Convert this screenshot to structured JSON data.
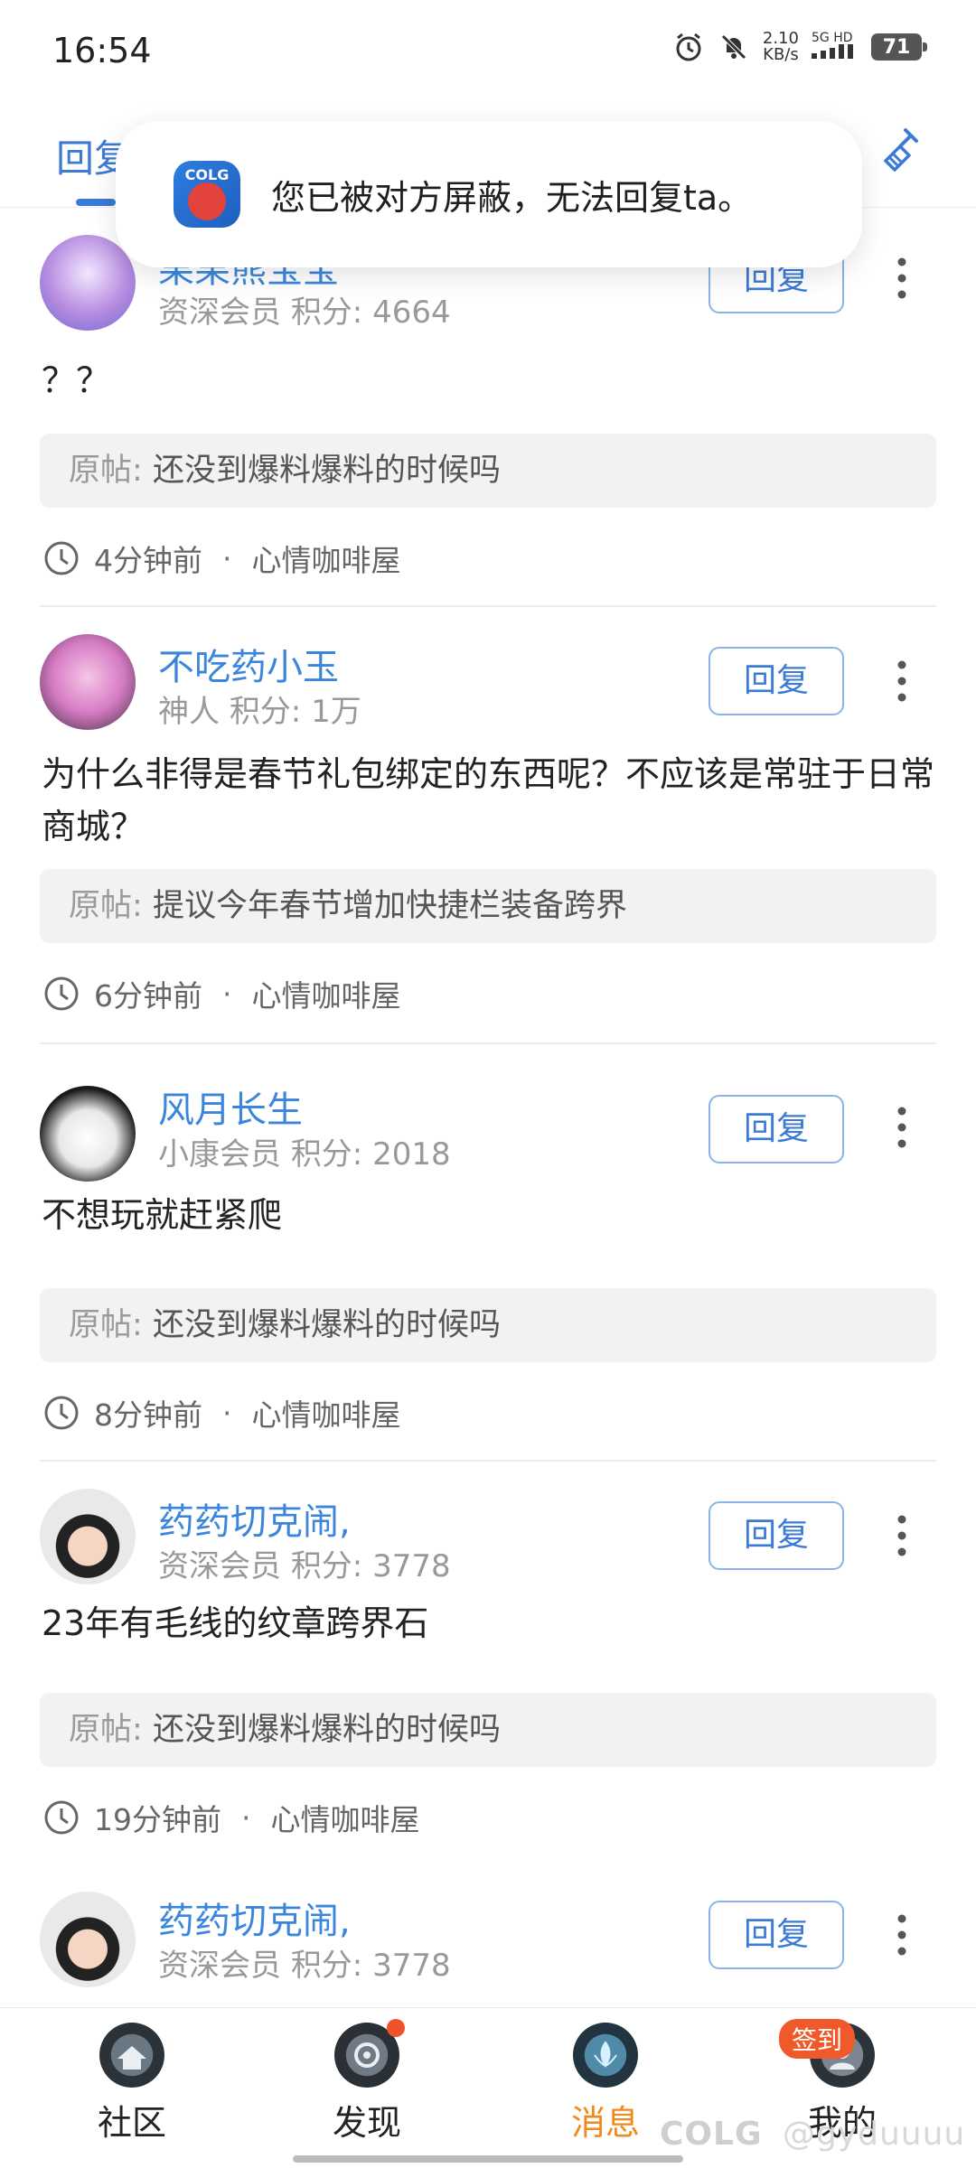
{
  "status_bar": {
    "time": "16:54",
    "net_speed_value": "2.10",
    "net_speed_unit": "KB/s",
    "signal_label": "5G HD",
    "battery": "71"
  },
  "header": {
    "tab_label": "回复"
  },
  "toast": {
    "message": "您已被对方屏蔽，无法回复ta。"
  },
  "reply_button_label": "回复",
  "quote_prefix": "原帖:",
  "cards": [
    {
      "username": "果果熊宝宝",
      "rank": "资深会员",
      "score": "积分: 4664",
      "comment": "？？",
      "quote": "还没到爆料爆料的时候吗",
      "time": "4分钟前",
      "board": "心情咖啡屋"
    },
    {
      "username": "不吃药小玉",
      "rank": "神人",
      "score": "积分: 1万",
      "comment": "为什么非得是春节礼包绑定的东西呢？不应该是常驻于日常商城？",
      "quote": "提议今年春节增加快捷栏装备跨界",
      "time": "6分钟前",
      "board": "心情咖啡屋"
    },
    {
      "username": "风月长生",
      "rank": "小康会员",
      "score": "积分: 2018",
      "comment": "不想玩就赶紧爬",
      "quote": "还没到爆料爆料的时候吗",
      "time": "8分钟前",
      "board": "心情咖啡屋"
    },
    {
      "username": "药药切克闹,",
      "rank": "资深会员",
      "score": "积分: 3778",
      "comment": "23年有毛线的纹章跨界石",
      "quote": "还没到爆料爆料的时候吗",
      "time": "19分钟前",
      "board": "心情咖啡屋"
    },
    {
      "username": "药药切克闹,",
      "rank": "资深会员",
      "score": "积分: 3778"
    }
  ],
  "bottom_nav": {
    "items": [
      {
        "label": "社区",
        "icon": "community-icon"
      },
      {
        "label": "发现",
        "icon": "discover-icon"
      },
      {
        "label": "消息",
        "icon": "message-icon"
      },
      {
        "label": "我的",
        "icon": "profile-icon"
      }
    ],
    "active": "消息",
    "signin_badge": "签到",
    "watermark": "@gyduuuu",
    "watermark_logo": "COLG"
  },
  "colors": {
    "accent_blue": "#3b7ad6",
    "active_orange": "#f08a1e",
    "badge_red": "#f05a2b"
  }
}
